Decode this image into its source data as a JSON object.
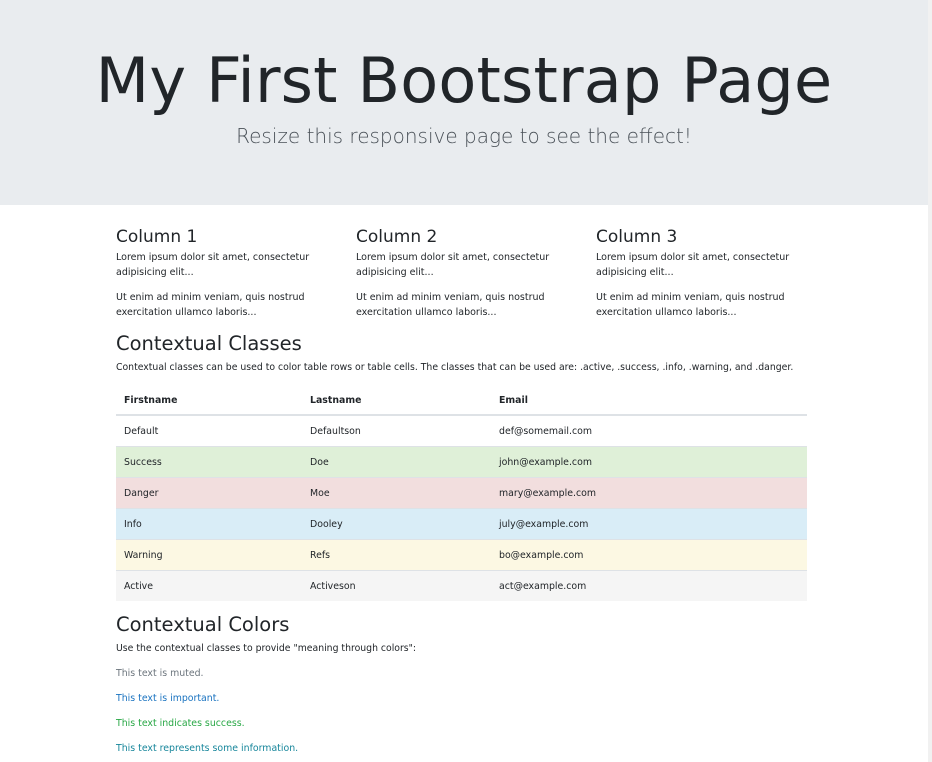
{
  "jumbotron": {
    "title": "My First Bootstrap Page",
    "subtitle": "Resize this responsive page to see the effect!"
  },
  "columns": [
    {
      "heading": "Column 1",
      "p1": "Lorem ipsum dolor sit amet, consectetur adipisicing elit...",
      "p2": "Ut enim ad minim veniam, quis nostrud exercitation ullamco laboris..."
    },
    {
      "heading": "Column 2",
      "p1": "Lorem ipsum dolor sit amet, consectetur adipisicing elit...",
      "p2": "Ut enim ad minim veniam, quis nostrud exercitation ullamco laboris..."
    },
    {
      "heading": "Column 3",
      "p1": "Lorem ipsum dolor sit amet, consectetur adipisicing elit...",
      "p2": "Ut enim ad minim veniam, quis nostrud exercitation ullamco laboris..."
    }
  ],
  "contextual_classes": {
    "title": "Contextual Classes",
    "description": "Contextual classes can be used to color table rows or table cells. The classes that can be used are: .active, .success, .info, .warning, and .danger.",
    "table": {
      "headers": [
        "Firstname",
        "Lastname",
        "Email"
      ],
      "rows": [
        {
          "firstname": "Default",
          "lastname": "Defaultson",
          "email": "def@somemail.com",
          "bg": "#ffffff"
        },
        {
          "firstname": "Success",
          "lastname": "Doe",
          "email": "john@example.com",
          "bg": "#dff0d8"
        },
        {
          "firstname": "Danger",
          "lastname": "Moe",
          "email": "mary@example.com",
          "bg": "#f2dede"
        },
        {
          "firstname": "Info",
          "lastname": "Dooley",
          "email": "july@example.com",
          "bg": "#d9edf7"
        },
        {
          "firstname": "Warning",
          "lastname": "Refs",
          "email": "bo@example.com",
          "bg": "#fcf8e3"
        },
        {
          "firstname": "Active",
          "lastname": "Activeson",
          "email": "act@example.com",
          "bg": "#f5f5f5"
        }
      ]
    }
  },
  "contextual_colors": {
    "title": "Contextual Colors",
    "description": "Use the contextual classes to provide \"meaning through colors\":",
    "lines": [
      {
        "text": "This text is muted.",
        "color": "#6c757d"
      },
      {
        "text": "This text is important.",
        "color": "#1a73c0"
      },
      {
        "text": "This text indicates success.",
        "color": "#28a745"
      },
      {
        "text": "This text represents some information.",
        "color": "#17869b"
      }
    ]
  }
}
